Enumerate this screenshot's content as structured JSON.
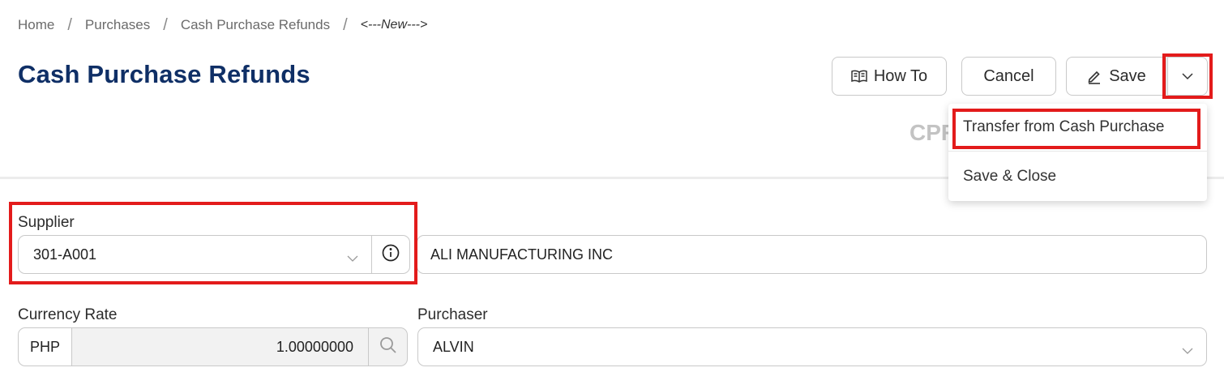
{
  "breadcrumb": {
    "items": [
      "Home",
      "Purchases",
      "Cash Purchase Refunds"
    ],
    "current": "<---New--->"
  },
  "page": {
    "title": "Cash Purchase Refunds",
    "doc_number_partial": "CPR"
  },
  "toolbar": {
    "howto_label": "How To",
    "cancel_label": "Cancel",
    "save_label": "Save"
  },
  "save_menu": {
    "items": [
      "Transfer from Cash Purchase",
      "Save & Close"
    ]
  },
  "form": {
    "supplier": {
      "label": "Supplier",
      "code": "301-A001",
      "name": "ALI MANUFACTURING INC"
    },
    "currency_rate": {
      "label": "Currency Rate",
      "code": "PHP",
      "value": "1.00000000"
    },
    "purchaser": {
      "label": "Purchaser",
      "value": "ALVIN"
    }
  },
  "colors": {
    "title": "#0f2f66",
    "annotation": "#e31b1b"
  }
}
